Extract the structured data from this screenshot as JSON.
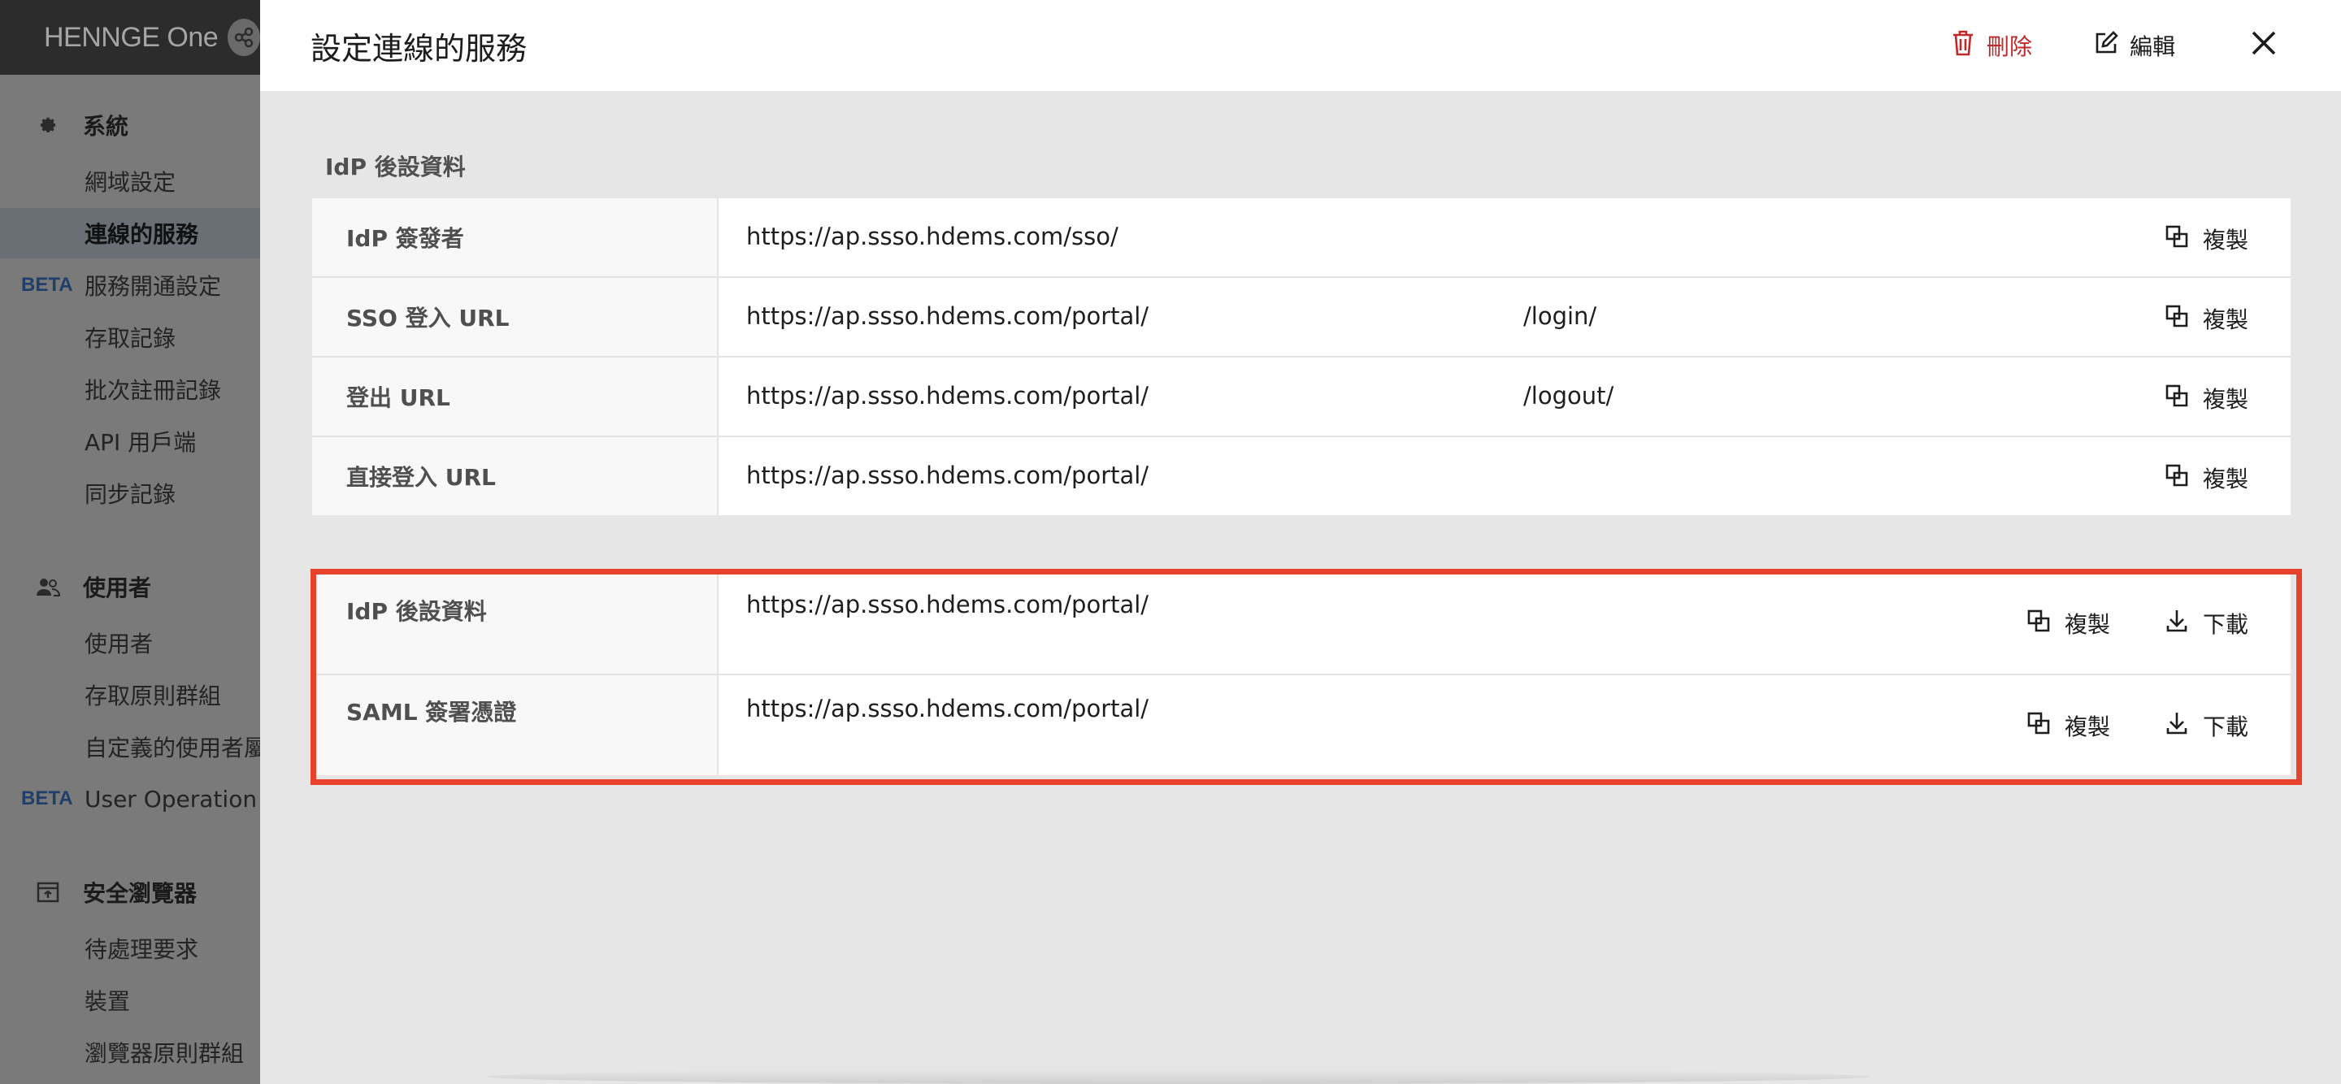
{
  "brand": {
    "logo_text": "HENNGE One"
  },
  "sidebar": {
    "sections": [
      {
        "title": "系統",
        "icon": "gear-icon"
      },
      {
        "title": "使用者",
        "icon": "users-icon"
      },
      {
        "title": "安全瀏覽器",
        "icon": "secure-browser-icon"
      }
    ],
    "items": [
      {
        "label": "網域設定"
      },
      {
        "label": "連線的服務",
        "active": true
      },
      {
        "label": "服務開通設定",
        "badge": "BETA"
      },
      {
        "label": "存取記錄"
      },
      {
        "label": "批次註冊記錄"
      },
      {
        "label": "API 用戶端"
      },
      {
        "label": "同步記錄"
      },
      {
        "label": "使用者"
      },
      {
        "label": "存取原則群組"
      },
      {
        "label": "自定義的使用者屬性"
      },
      {
        "label": "User Operation Logs",
        "badge": "BETA"
      },
      {
        "label": "待處理要求"
      },
      {
        "label": "裝置"
      },
      {
        "label": "瀏覽器原則群組"
      }
    ]
  },
  "modal": {
    "title": "設定連線的服務",
    "delete_label": "刪除",
    "edit_label": "編輯",
    "close_icon": "close-icon",
    "delete_color": "#c0282a",
    "section_title": "IdP 後設資料",
    "copy_label": "複製",
    "download_label": "下載",
    "rows": [
      {
        "label": "IdP 簽發者",
        "url": "https://ap.ssso.hdems.com/sso/",
        "url_tail": ""
      },
      {
        "label": "SSO 登入 URL",
        "url": "https://ap.ssso.hdems.com/portal/",
        "url_tail": "/login/"
      },
      {
        "label": "登出 URL",
        "url": "https://ap.ssso.hdems.com/portal/",
        "url_tail": "/logout/"
      },
      {
        "label": "直接登入 URL",
        "url": "https://ap.ssso.hdems.com/portal/",
        "url_tail": ""
      }
    ],
    "download_rows": [
      {
        "label": "IdP 後設資料",
        "url": "https://ap.ssso.hdems.com/portal/"
      },
      {
        "label": "SAML 簽署憑證",
        "url": "https://ap.ssso.hdems.com/portal/"
      }
    ],
    "highlight_color": "#e8422c"
  }
}
